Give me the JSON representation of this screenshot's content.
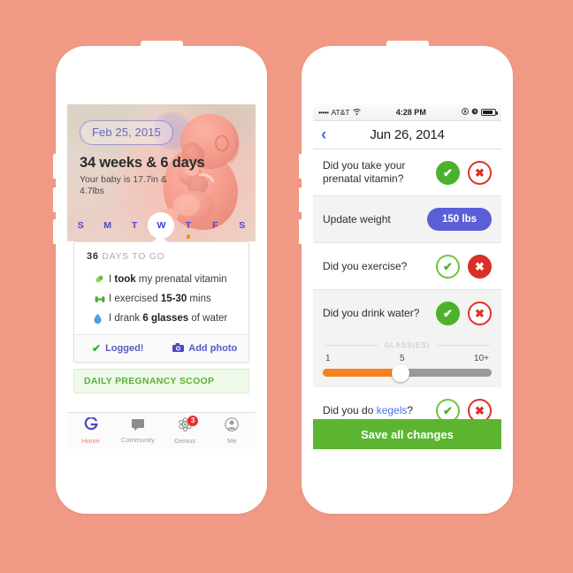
{
  "theme": {
    "background": "#f09a86",
    "accent_green": "#5cb531",
    "accent_red": "#d93025",
    "accent_blue": "#5b5fd6",
    "accent_orange": "#f58220",
    "link_blue": "#4b6fe0"
  },
  "left_phone": {
    "hero": {
      "date_pill": "Feb 25, 2015",
      "weeks": "34 weeks & 6 days",
      "subtitle": "Your baby is 17.7in & 4.7lbs",
      "days": [
        {
          "label": "S",
          "active": false,
          "dot": false
        },
        {
          "label": "M",
          "active": false,
          "dot": false
        },
        {
          "label": "T",
          "active": false,
          "dot": false
        },
        {
          "label": "W",
          "active": true,
          "dot": false
        },
        {
          "label": "T",
          "active": false,
          "dot": true
        },
        {
          "label": "F",
          "active": false,
          "dot": false
        },
        {
          "label": "S",
          "active": false,
          "dot": false
        }
      ]
    },
    "card": {
      "days_to_go_count": "36",
      "days_to_go_label": "DAYS TO GO",
      "items": [
        {
          "icon": "pill-icon",
          "pre": "I ",
          "bold": "took",
          "post": " my prenatal vitamin"
        },
        {
          "icon": "dumbbell-icon",
          "pre": "I exercised ",
          "bold": "15-30",
          "post": " mins"
        },
        {
          "icon": "water-drop-icon",
          "pre": "I drank ",
          "bold": "6 glasses",
          "post": " of water"
        }
      ],
      "footer": {
        "logged_label": "Logged!",
        "add_photo_label": "Add photo"
      }
    },
    "scoop_banner": "DAILY PREGNANCY SCOOP",
    "tabbar": [
      {
        "icon": "glow-logo-icon",
        "label": "Home",
        "active": true,
        "badge": ""
      },
      {
        "icon": "chat-bubble-icon",
        "label": "Community",
        "active": false,
        "badge": ""
      },
      {
        "icon": "atom-icon",
        "label": "Genius",
        "active": false,
        "badge": "3"
      },
      {
        "icon": "person-icon",
        "label": "Me",
        "active": false,
        "badge": ""
      }
    ]
  },
  "right_phone": {
    "statusbar": {
      "signal_dots": "•••••",
      "carrier": "AT&T",
      "wifi_icon": "wifi-icon",
      "time": "4:28 PM",
      "icons": [
        "location-icon",
        "alarm-icon"
      ],
      "battery_level": 85
    },
    "navbar": {
      "back_icon": "chevron-left-icon",
      "title": "Jun 26, 2014"
    },
    "rows": [
      {
        "type": "yesno",
        "question": "Did you take your prenatal vitamin?",
        "yes_state": "on",
        "no_state": "off",
        "alt": false
      },
      {
        "type": "pill",
        "question": "Update weight",
        "pill_value": "150 lbs",
        "alt": true
      },
      {
        "type": "yesno",
        "question": "Did you exercise?",
        "yes_state": "off",
        "no_state": "on",
        "alt": false
      },
      {
        "type": "yesno-slider",
        "question": "Did you drink water?",
        "yes_state": "on",
        "no_state": "off",
        "alt": true,
        "slider": {
          "caption": "GLASS(ES)",
          "min_label": "1",
          "mid_label": "5",
          "max_label": "10+",
          "value": 5,
          "fill_percent": 46
        }
      },
      {
        "type": "yesno-link",
        "question_pre": "Did you do ",
        "question_link": "kegels",
        "question_post": "?",
        "yes_state": "off",
        "no_state": "off",
        "alt": false
      }
    ],
    "save_button": "Save all changes"
  }
}
